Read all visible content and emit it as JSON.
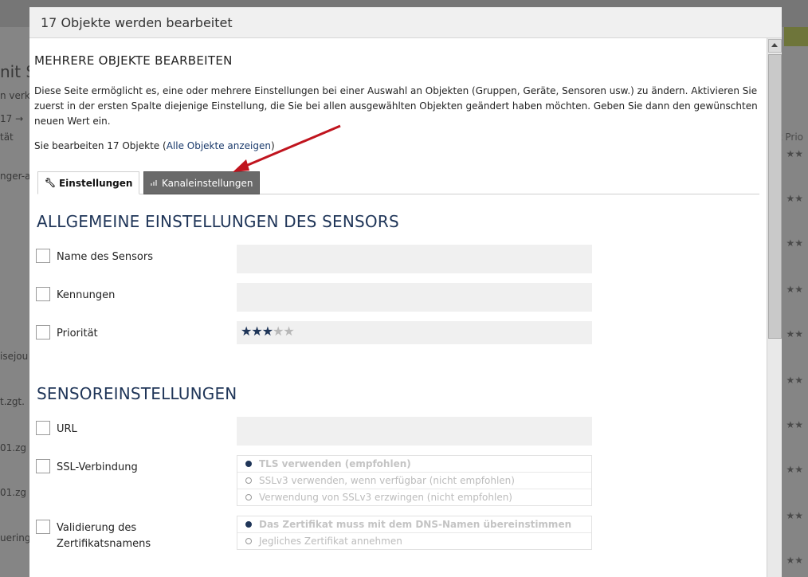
{
  "background": {
    "left_items": [
      "nit S",
      "n verk",
      "17 →",
      "tät",
      "nger-a",
      "isejou",
      "t.zgt.",
      "01.zg",
      "01.zg",
      "uering"
    ],
    "right_header": "t Prio"
  },
  "dialog": {
    "title": "17 Objekte werden bearbeitet",
    "heading": "MEHRERE OBJEKTE BEARBEITEN",
    "intro": "Diese Seite ermöglicht es, eine oder mehrere Einstellungen bei einer Auswahl an Objekten (Gruppen, Geräte, Sensoren usw.) zu ändern. Aktivieren Sie zuerst in der ersten Spalte diejenige Einstellung, die Sie bei allen ausgewählten Objekten geändert haben möchten. Geben Sie dann den gewünschten neuen Wert ein.",
    "editing_prefix": "Sie bearbeiten 17 Objekte (",
    "editing_link": "Alle Objekte anzeigen",
    "editing_suffix": ")",
    "tabs": [
      {
        "label": "Einstellungen",
        "icon": "wrench-icon",
        "active": true
      },
      {
        "label": "Kanaleinstellungen",
        "icon": "bar-chart-icon",
        "active": false
      }
    ],
    "section1": {
      "title": "ALLGEMEINE EINSTELLUNGEN DES SENSORS",
      "rows": [
        {
          "label": "Name des Sensors",
          "value": ""
        },
        {
          "label": "Kennungen",
          "value": ""
        },
        {
          "label": "Priorität",
          "stars_on": 3,
          "stars_total": 5
        }
      ]
    },
    "section2": {
      "title": "SENSOREINSTELLUNGEN",
      "url_label": "URL",
      "ssl_label": "SSL-Verbindung",
      "ssl_options": [
        "TLS verwenden (empfohlen)",
        "SSLv3 verwenden, wenn verfügbar (nicht empfohlen)",
        "Verwendung von SSLv3 erzwingen (nicht empfohlen)"
      ],
      "cert_label_line1": "Validierung des",
      "cert_label_line2": "Zertifikatsnamens",
      "cert_options": [
        "Das Zertifikat muss mit dem DNS-Namen übereinstimmen",
        "Jegliches Zertifikat annehmen"
      ]
    }
  },
  "colors": {
    "accent": "#1f3558",
    "annotation_arrow": "#c0141e",
    "inactive_tab": "#6a6a6a"
  }
}
